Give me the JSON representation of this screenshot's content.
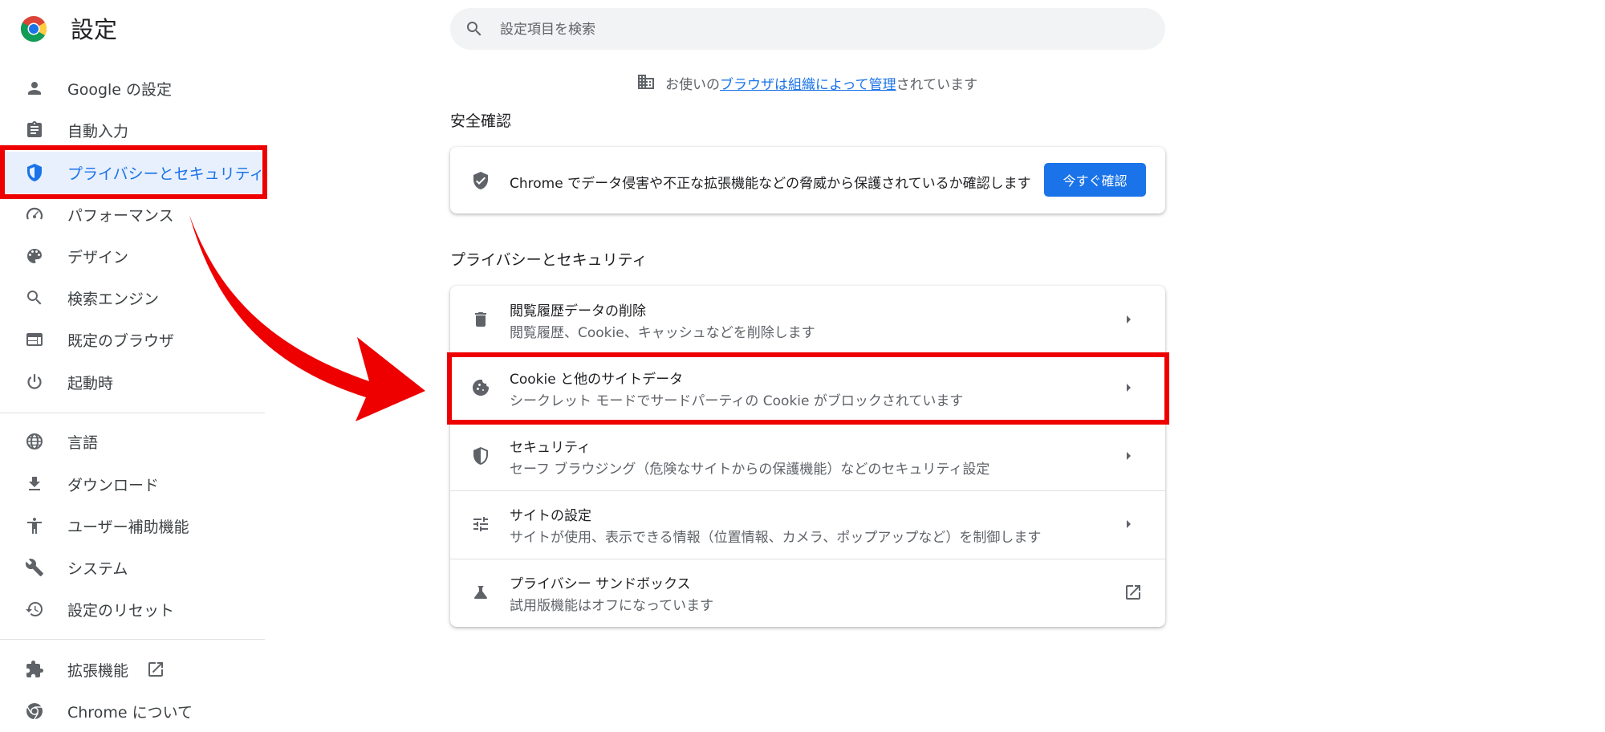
{
  "app": {
    "title": "設定",
    "logo_icon": "chrome-logo-icon"
  },
  "search": {
    "placeholder": "設定項目を検索",
    "icon": "search-icon"
  },
  "sidebar": {
    "items": [
      {
        "label": "Google の設定",
        "icon": "person-icon"
      },
      {
        "label": "自動入力",
        "icon": "clipboard-icon"
      },
      {
        "label": "プライバシーとセキュリティ",
        "icon": "shield-icon",
        "active": true
      },
      {
        "label": "パフォーマンス",
        "icon": "speedometer-icon"
      },
      {
        "label": "デザイン",
        "icon": "palette-icon"
      },
      {
        "label": "検索エンジン",
        "icon": "search-icon"
      },
      {
        "label": "既定のブラウザ",
        "icon": "browser-window-icon"
      },
      {
        "label": "起動時",
        "icon": "power-icon"
      },
      {
        "label": "言語",
        "icon": "globe-icon"
      },
      {
        "label": "ダウンロード",
        "icon": "download-icon"
      },
      {
        "label": "ユーザー補助機能",
        "icon": "accessibility-icon"
      },
      {
        "label": "システム",
        "icon": "wrench-icon"
      },
      {
        "label": "設定のリセット",
        "icon": "history-icon"
      },
      {
        "label": "拡張機能",
        "icon": "puzzle-icon",
        "external": true
      },
      {
        "label": "Chrome について",
        "icon": "chrome-icon"
      }
    ]
  },
  "managed_notice": {
    "prefix": "お使いの",
    "link": "ブラウザは組織によって管理",
    "suffix": "されています",
    "icon": "building-icon"
  },
  "safety_check": {
    "section_title": "安全確認",
    "text": "Chrome でデータ侵害や不正な拡張機能などの脅威から保護されているか確認します",
    "button_label": "今すぐ確認",
    "icon": "shield-check-icon"
  },
  "privacy": {
    "section_title": "プライバシーとセキュリティ",
    "rows": [
      {
        "title": "閲覧履歴データの削除",
        "subtitle": "閲覧履歴、Cookie、キャッシュなどを削除します",
        "icon": "trash-icon",
        "action_icon": "chevron-right-icon"
      },
      {
        "title": "Cookie と他のサイトデータ",
        "subtitle": "シークレット モードでサードパーティの Cookie がブロックされています",
        "icon": "cookie-icon",
        "action_icon": "chevron-right-icon",
        "highlighted": true
      },
      {
        "title": "セキュリティ",
        "subtitle": "セーフ ブラウジング（危険なサイトからの保護機能）などのセキュリティ設定",
        "icon": "shield-half-icon",
        "action_icon": "chevron-right-icon"
      },
      {
        "title": "サイトの設定",
        "subtitle": "サイトが使用、表示できる情報（位置情報、カメラ、ポップアップなど）を制御します",
        "icon": "tune-icon",
        "action_icon": "chevron-right-icon"
      },
      {
        "title": "プライバシー サンドボックス",
        "subtitle": "試用版機能はオフになっています",
        "icon": "flask-icon",
        "action_icon": "open-in-new-icon"
      }
    ]
  },
  "colors": {
    "accent": "#1a73e8",
    "highlight": "#ee0000",
    "active_bg": "#e8f0fe"
  }
}
